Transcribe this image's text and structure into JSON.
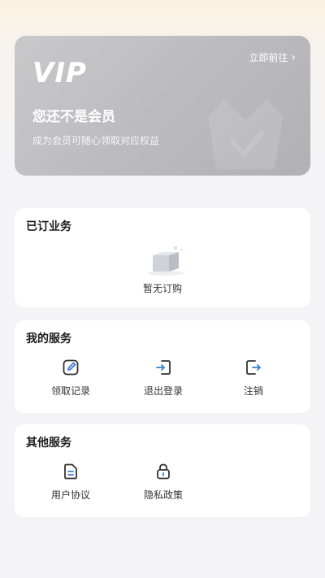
{
  "vip": {
    "logo": "VIP",
    "goto_label": "立即前往",
    "title": "您还不是会员",
    "subtitle": "成为会员可随心领取对应权益"
  },
  "subscribed": {
    "title": "已订业务",
    "empty_text": "暂无订购"
  },
  "my_services": {
    "title": "我的服务",
    "items": [
      {
        "label": "领取记录",
        "icon": "edit-icon"
      },
      {
        "label": "退出登录",
        "icon": "logout-icon"
      },
      {
        "label": "注销",
        "icon": "cancel-account-icon"
      }
    ]
  },
  "other_services": {
    "title": "其他服务",
    "items": [
      {
        "label": "用户协议",
        "icon": "document-icon"
      },
      {
        "label": "隐私政策",
        "icon": "lock-icon"
      }
    ]
  },
  "colors": {
    "accent": "#3a7bd5",
    "vip_card": "#bdbdc0"
  }
}
